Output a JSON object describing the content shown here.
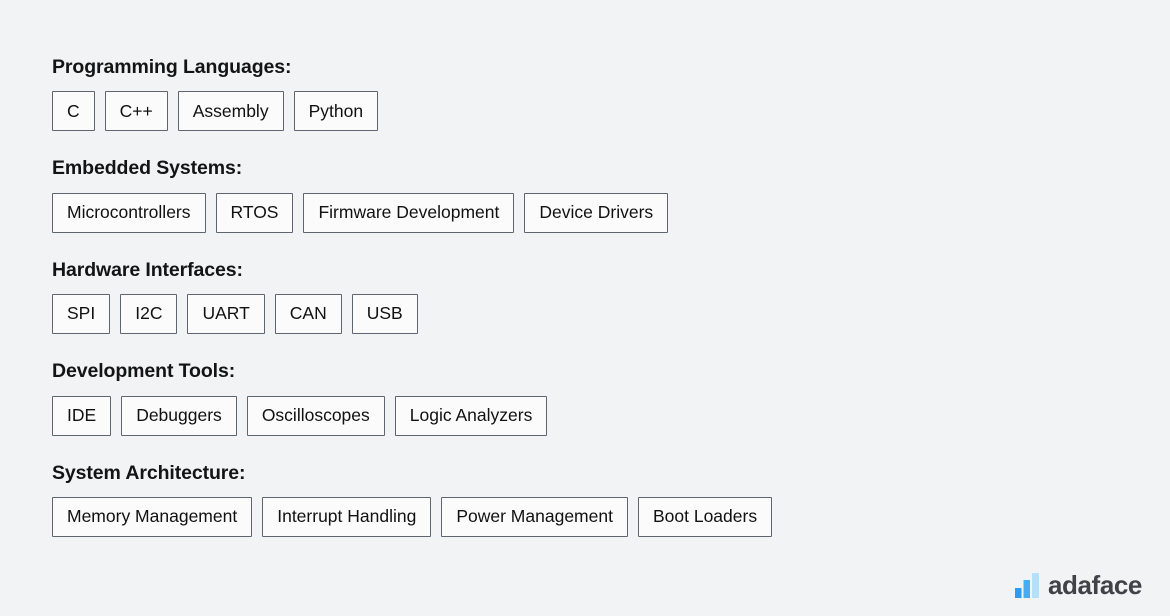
{
  "page": {
    "background_color": "#f2f3f5",
    "tag_border_color": "#5f6570",
    "tag_fill_color": "#fbfbfc",
    "heading_color": "#141414"
  },
  "sections": [
    {
      "title": "Programming Languages:",
      "tags": [
        "C",
        "C++",
        "Assembly",
        "Python"
      ]
    },
    {
      "title": "Embedded Systems:",
      "tags": [
        "Microcontrollers",
        "RTOS",
        "Firmware Development",
        "Device Drivers"
      ]
    },
    {
      "title": "Hardware Interfaces:",
      "tags": [
        "SPI",
        "I2C",
        "UART",
        "CAN",
        "USB"
      ]
    },
    {
      "title": "Development Tools:",
      "tags": [
        "IDE",
        "Debuggers",
        "Oscilloscopes",
        "Logic Analyzers"
      ]
    },
    {
      "title": "System Architecture:",
      "tags": [
        "Memory Management",
        "Interrupt Handling",
        "Power Management",
        "Boot Loaders"
      ]
    }
  ],
  "logo": {
    "icon": "bar-chart-logo-icon",
    "wordmark": "adaface",
    "bar_colors": [
      "#2e9bf0",
      "#47acf2",
      "#b6dffa"
    ],
    "wordmark_color": "#3f4247"
  }
}
